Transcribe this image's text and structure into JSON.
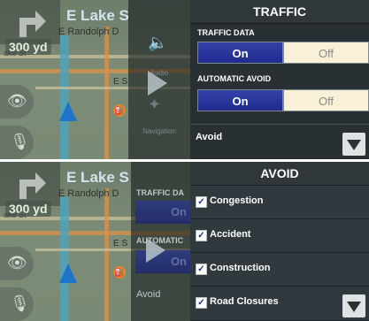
{
  "map": {
    "street_primary": "E Lake S",
    "street_secondary": "E Randolph D",
    "street_tertiary": "ake St",
    "street_e": "E S",
    "distance": "300 yd"
  },
  "side_menu": {
    "audio_label": "Audio",
    "navigation_label": "Navigation"
  },
  "traffic_panel": {
    "title": "TRAFFIC",
    "traffic_data": {
      "label": "TRAFFIC DATA",
      "on_label": "On",
      "off_label": "Off",
      "selected": "On"
    },
    "automatic_avoid": {
      "label": "AUTOMATIC AVOID",
      "on_label": "On",
      "off_label": "Off",
      "selected": "On"
    },
    "avoid_label": "Avoid"
  },
  "avoid_panel": {
    "title": "AVOID",
    "items": [
      {
        "label": "Congestion",
        "checked": true
      },
      {
        "label": "Accident",
        "checked": true
      },
      {
        "label": "Construction",
        "checked": true
      },
      {
        "label": "Road Closures",
        "checked": true
      }
    ]
  },
  "ghost_underlay": {
    "traffic_data_label": "TRAFFIC DA",
    "automatic_label": "AUTOMATIC",
    "on_label": "On",
    "avoid_label": "Avoid"
  },
  "colors": {
    "accent_on": "#1f2b8f",
    "off_background": "#f8f1d8",
    "panel_background": "#293033"
  }
}
